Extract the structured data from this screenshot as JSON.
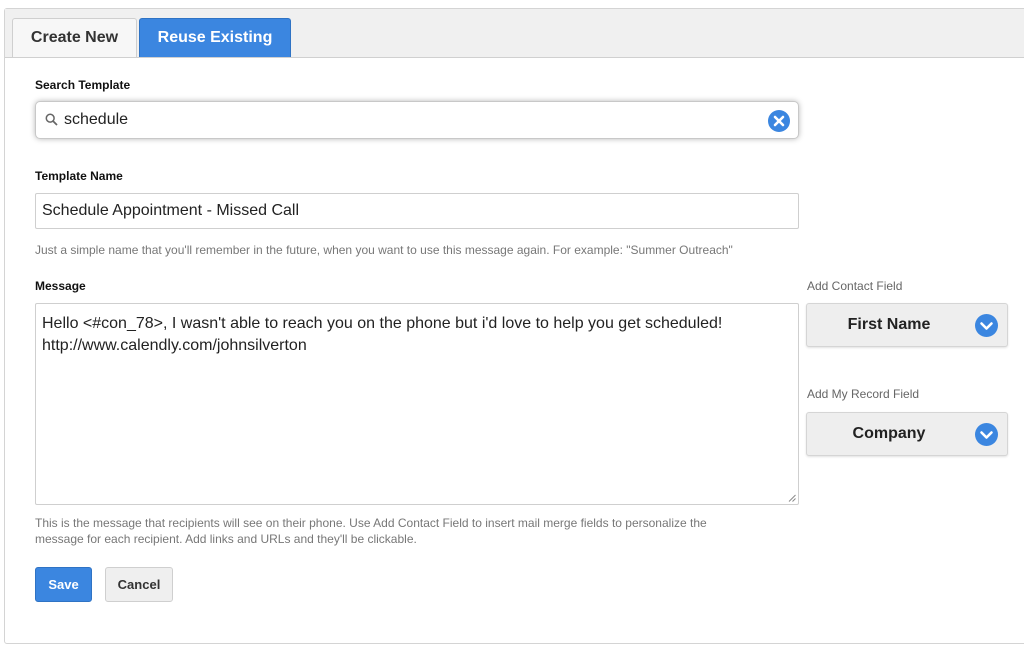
{
  "tabs": {
    "create_new": "Create New",
    "reuse_existing": "Reuse Existing",
    "active": "Reuse Existing"
  },
  "search": {
    "label": "Search Template",
    "value": "schedule",
    "search_icon": "search-icon",
    "clear_icon": "clear-circle-x-icon"
  },
  "template_name": {
    "label": "Template Name",
    "value": "Schedule Appointment - Missed Call",
    "help": "Just a simple name that you'll remember in the future, when you want to use this message again. For example: \"Summer Outreach\""
  },
  "message": {
    "label": "Message",
    "line1": "Hello <#con_78>, I wasn't able to reach you on the phone but i'd love to help you get scheduled!",
    "line2": "http://www.calendly.com/johnsilverton",
    "help_line1": "This is the message that recipients will see on their phone. Use Add Contact Field to insert mail merge fields to personalize the",
    "help_line2": "message for each recipient. Add links and URLs and they'll be clickable."
  },
  "contact_field": {
    "label": "Add Contact Field",
    "selected": "First Name",
    "icon": "chevron-down-circle-icon"
  },
  "record_field": {
    "label": "Add My Record Field",
    "selected": "Company",
    "icon": "chevron-down-circle-icon"
  },
  "actions": {
    "save": "Save",
    "cancel": "Cancel"
  },
  "colors": {
    "accent": "#3b86e0",
    "clear_icon": "#3b86e0"
  }
}
